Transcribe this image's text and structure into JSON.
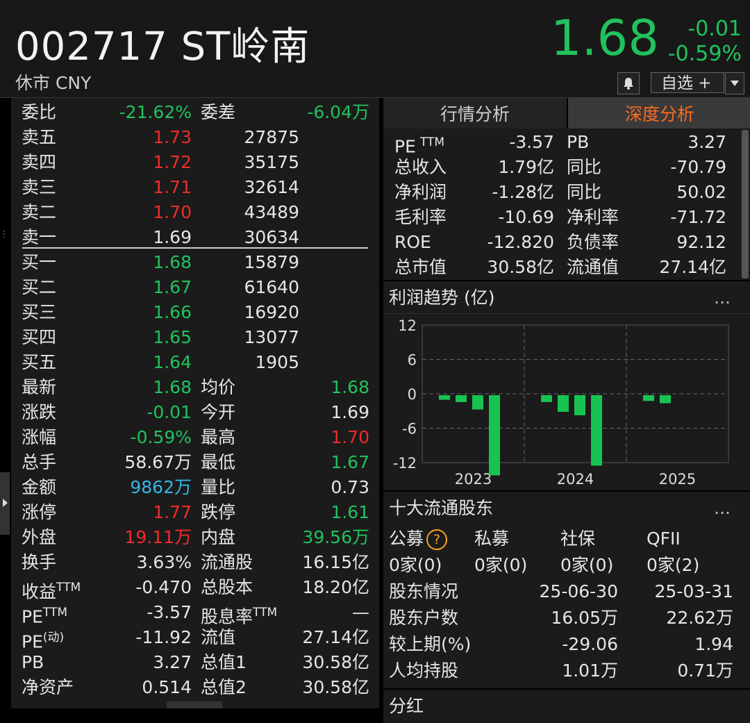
{
  "header": {
    "code_name": "002717 ST岭南",
    "market_status": "休市 CNY",
    "price": "1.68",
    "change": "-0.01",
    "change_pct": "-0.59%",
    "watch_label": "自选 +"
  },
  "left": {
    "weibi_label": "委比",
    "weibi_value": "-21.62%",
    "weicha_label": "委差",
    "weicha_value": "-6.04万",
    "asks": [
      {
        "label": "卖五",
        "price": "1.73",
        "vol": "27875"
      },
      {
        "label": "卖四",
        "price": "1.72",
        "vol": "35175"
      },
      {
        "label": "卖三",
        "price": "1.71",
        "vol": "32614"
      },
      {
        "label": "卖二",
        "price": "1.70",
        "vol": "43489"
      },
      {
        "label": "卖一",
        "price": "1.69",
        "vol": "30634"
      }
    ],
    "bids": [
      {
        "label": "买一",
        "price": "1.68",
        "vol": "15879"
      },
      {
        "label": "买二",
        "price": "1.67",
        "vol": "61640"
      },
      {
        "label": "买三",
        "price": "1.66",
        "vol": "16920"
      },
      {
        "label": "买四",
        "price": "1.65",
        "vol": "13077"
      },
      {
        "label": "买五",
        "price": "1.64",
        "vol": "1905"
      }
    ],
    "stats": [
      {
        "l1": "最新",
        "v1": "1.68",
        "l2": "均价",
        "v2": "1.68"
      },
      {
        "l1": "涨跌",
        "v1": "-0.01",
        "l2": "今开",
        "v2": "1.69"
      },
      {
        "l1": "涨幅",
        "v1": "-0.59%",
        "l2": "最高",
        "v2": "1.70"
      },
      {
        "l1": "总手",
        "v1": "58.67万",
        "l2": "最低",
        "v2": "1.67"
      },
      {
        "l1": "金额",
        "v1": "9862万",
        "l2": "量比",
        "v2": "0.73"
      },
      {
        "l1": "涨停",
        "v1": "1.77",
        "l2": "跌停",
        "v2": "1.61"
      },
      {
        "l1": "外盘",
        "v1": "19.11万",
        "l2": "内盘",
        "v2": "39.56万"
      },
      {
        "l1": "换手",
        "v1": "3.63%",
        "l2": "流通股",
        "v2": "16.15亿"
      },
      {
        "l1": "收益",
        "l1sup": "TTM",
        "v1": "-0.470",
        "l2": "总股本",
        "v2": "18.20亿"
      },
      {
        "l1": "PE",
        "l1sup": "TTM",
        "v1": "-3.57",
        "l2": "股息率",
        "l2sup": "TTM",
        "v2": "—"
      },
      {
        "l1": "PE",
        "l1sup": "(动)",
        "v1": "-11.92",
        "l2": "流值",
        "v2": "27.14亿"
      },
      {
        "l1": "PB",
        "v1": "3.27",
        "l2": "总值1",
        "v2": "30.58亿"
      },
      {
        "l1": "净资产",
        "v1": "0.514",
        "l2": "总值2",
        "v2": "30.58亿"
      }
    ],
    "colors": {
      "green": "#21c25e",
      "red": "#ee2c2c",
      "blue": "#37b6e6",
      "white": "#e6e6e6"
    }
  },
  "right": {
    "tab_market": "行情分析",
    "tab_deep": "深度分析",
    "fin": [
      {
        "l1": "PE",
        "l1sup": "TTM",
        "v1": "-3.57",
        "l2": "PB",
        "v2": "3.27"
      },
      {
        "l1": "总收入",
        "v1": "1.79亿",
        "l2": "同比",
        "v2": "-70.79"
      },
      {
        "l1": "净利润",
        "v1": "-1.28亿",
        "l2": "同比",
        "v2": "50.02"
      },
      {
        "l1": "毛利率",
        "v1": "-10.69",
        "l2": "净利率",
        "v2": "-71.72"
      },
      {
        "l1": "ROE",
        "v1": "-12.820",
        "l2": "负债率",
        "v2": "92.12"
      },
      {
        "l1": "总市值",
        "v1": "30.58亿",
        "l2": "流通值",
        "v2": "27.14亿"
      }
    ],
    "profit_title": "利润趋势 (亿)",
    "more": "...",
    "holders_title": "十大流通股东",
    "holders_types": [
      "公募",
      "私募",
      "社保",
      "QFII"
    ],
    "holders_counts": [
      "0家(0)",
      "0家(0)",
      "0家(0)",
      "0家(2)"
    ],
    "help": "?",
    "holder_table": [
      {
        "label": "股东情况",
        "a": "25-06-30",
        "b": "25-03-31"
      },
      {
        "label": "股东户数",
        "a": "16.05万",
        "b": "22.62万"
      },
      {
        "label": "较上期(%)",
        "a": "-29.06",
        "b": "1.94"
      },
      {
        "label": "人均持股",
        "a": "1.01万",
        "b": "0.71万"
      }
    ],
    "dividend_title": "分红"
  },
  "chart_data": {
    "type": "bar",
    "title": "利润趋势 (亿)",
    "yticks": [
      "12",
      "6",
      "0",
      "-6",
      "-12"
    ],
    "ylim": [
      -12,
      12
    ],
    "xticks": [
      "2023",
      "2024",
      "2025"
    ],
    "values": [
      -0.8,
      -1.2,
      -2.5,
      -14,
      -1.2,
      -2.9,
      -3.5,
      -12.3,
      -1,
      -1.4
    ],
    "color": "#17c451"
  }
}
